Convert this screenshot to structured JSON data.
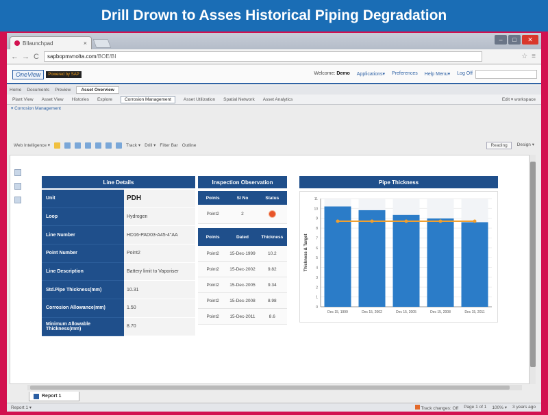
{
  "banner": {
    "title": "Drill Drown to Asses Historical Piping Degradation"
  },
  "browser": {
    "tab_title": "BIlaunchpad",
    "url_host": "sapbopmvnolta.com",
    "url_path": "/BOE/BI",
    "win_min": "–",
    "win_max": "□",
    "win_close": "✕"
  },
  "app": {
    "logo_text": "OneView",
    "logo_badge": "Powered by SAP",
    "welcome_label": "Welcome:",
    "user": "Demo",
    "menu": [
      "Applications▾",
      "Preferences",
      "Help Menu▾",
      "Log Off"
    ]
  },
  "doc_tabs": [
    "Home",
    "Documents",
    "Preview",
    "Asset Overview"
  ],
  "sub_tabs": [
    "Plant View",
    "Asset View",
    "Histories",
    "Explore",
    "Corrosion Management",
    "Asset Utilization",
    "Spatial Network",
    "Asset Analytics"
  ],
  "sub_tabs_right": "Edit ▾ workspace",
  "breadcrumb": "▾ Corrosion Management",
  "toolbar": {
    "left_label": "Web Intelligence ▾",
    "track": "Track ▾",
    "drill": "Drill ▾",
    "filter_bar": "Filter Bar",
    "outline": "Outline",
    "reading": "Reading",
    "design": "Design ▾"
  },
  "line_details": {
    "title": "Line Details",
    "rows": [
      {
        "key": "Unit",
        "value": "PDH"
      },
      {
        "key": "Loop",
        "value": "Hydrogen"
      },
      {
        "key": "Line Number",
        "value": "HD16-PAD03-A45-4\"AA"
      },
      {
        "key": "Point Number",
        "value": "Point2"
      },
      {
        "key": "Line Description",
        "value": "Battery limit to Vaporiser"
      },
      {
        "key": "Std.Pipe Thickness(mm)",
        "value": "10.31"
      },
      {
        "key": "Corrosion Allowance(mm)",
        "value": "1.50"
      },
      {
        "key": "Minimum Allowable Thickness(mm)",
        "value": "8.70"
      }
    ]
  },
  "inspection": {
    "title": "Inspection Observation",
    "obs_headers": [
      "Points",
      "Sl No",
      "Status"
    ],
    "obs_row": {
      "point": "Point2",
      "sl": "2"
    },
    "thk_headers": [
      "Points",
      "Dated",
      "Thickness"
    ],
    "thk_rows": [
      {
        "point": "Point2",
        "date": "15-Dec-1999",
        "val": "10.2"
      },
      {
        "point": "Point2",
        "date": "15-Dec-2002",
        "val": "9.82"
      },
      {
        "point": "Point2",
        "date": "15-Dec-2005",
        "val": "9.34"
      },
      {
        "point": "Point2",
        "date": "15-Dec-2008",
        "val": "8.98"
      },
      {
        "point": "Point2",
        "date": "15-Dec-2011",
        "val": "8.6"
      }
    ]
  },
  "pipe": {
    "title": "Pipe Thickness"
  },
  "chart_data": {
    "type": "bar",
    "title": "Pipe Thickness",
    "ylabel": "Thickness & Target",
    "categories": [
      "Dec 15, 1999",
      "Dec 15, 2002",
      "Dec 15, 2005",
      "Dec 15, 2008",
      "Dec 15, 2011"
    ],
    "series": [
      {
        "values": [
          10.2,
          9.82,
          9.34,
          8.98,
          8.6
        ],
        "color": "#2b7cc8"
      },
      {
        "values": [
          8.7,
          8.7,
          8.7,
          8.7,
          8.7
        ],
        "color": "#f0a030"
      }
    ],
    "yticks": [
      0,
      1,
      2,
      3,
      4,
      5,
      6,
      7,
      8,
      9,
      10,
      11
    ],
    "ylim": [
      0,
      11
    ],
    "grid": true
  },
  "footer": {
    "report_tab": "Report 1",
    "status_left": "Report 1 ▾",
    "track_changes": "Track changes: Off",
    "page": "Page 1 of 1",
    "zoom": "100% ▾",
    "updated": "3 years ago"
  }
}
